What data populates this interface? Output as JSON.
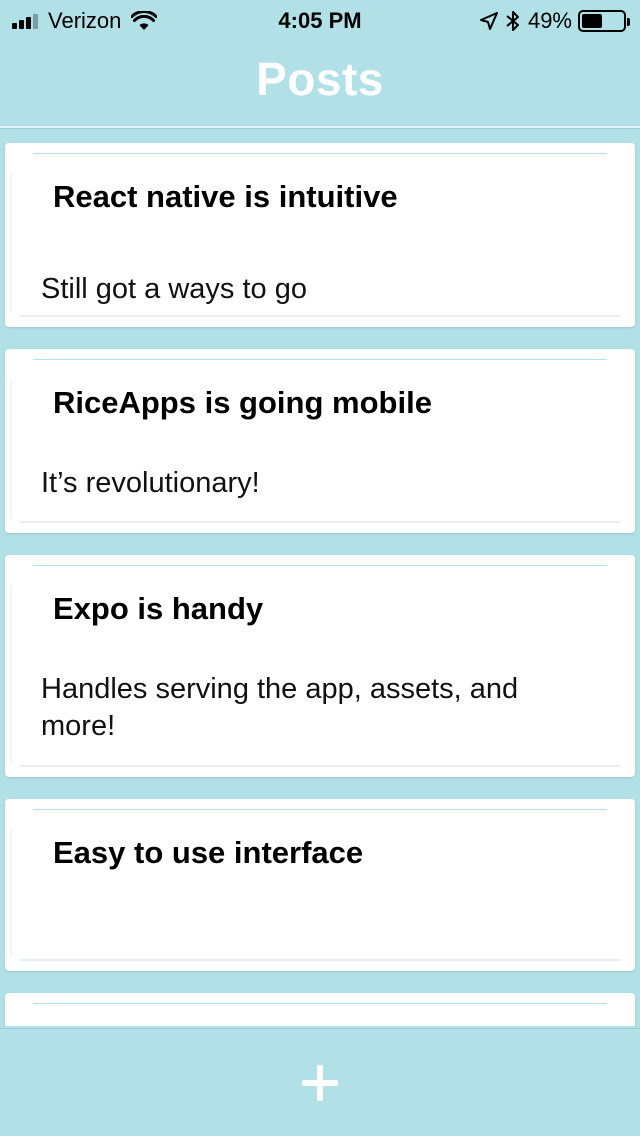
{
  "status_bar": {
    "carrier": "Verizon",
    "time": "4:05 PM",
    "battery_percent": "49%",
    "battery_level": 0.49,
    "icons": [
      "signal-icon",
      "wifi-icon",
      "location-arrow-icon",
      "bluetooth-icon",
      "battery-icon"
    ]
  },
  "header": {
    "title": "Posts"
  },
  "posts": [
    {
      "title": "React native is intuitive",
      "body": "Still got a ways to go"
    },
    {
      "title": "RiceApps is going mobile",
      "body": "It’s revolutionary!"
    },
    {
      "title": "Expo is handy",
      "body": "Handles serving the app, assets, and more!"
    },
    {
      "title": "Easy to use interface",
      "body": ""
    },
    {
      "title": "",
      "body": ""
    }
  ],
  "bottom_bar": {
    "add_icon": "plus-icon"
  },
  "colors": {
    "background": "#b1e0e6",
    "header_text": "#ffffff",
    "card": "#ffffff"
  }
}
